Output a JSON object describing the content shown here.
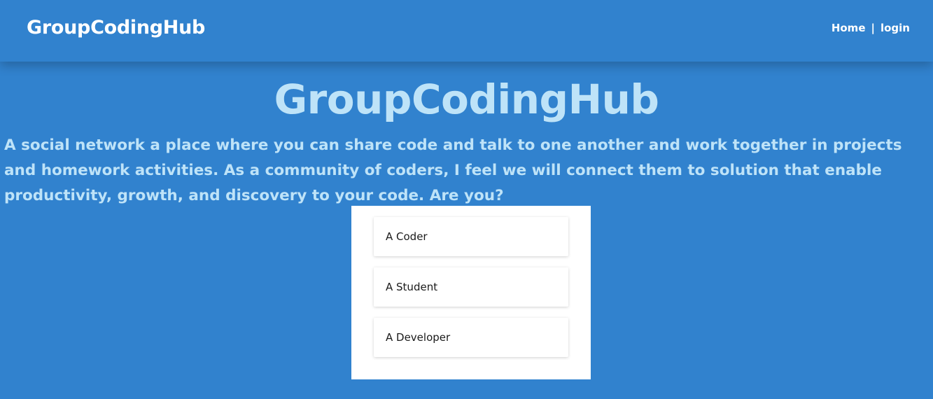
{
  "navbar": {
    "brand": "GroupCodingHub",
    "links": [
      {
        "label": "Home"
      },
      {
        "label": "login"
      }
    ],
    "separator": "|"
  },
  "hero": {
    "title": "GroupCodingHub",
    "description": "A social network a place where you can share code and talk to one another and work together in projects and homework activities. As a community of coders, I feel we will connect them to solution that enable productivity, growth, and discovery to your code. Are you?"
  },
  "choices": [
    {
      "label": "A Coder"
    },
    {
      "label": "A Student"
    },
    {
      "label": "A Developer"
    }
  ],
  "colors": {
    "background": "#3182ce",
    "hero_text": "#bee3f8",
    "nav_text": "#ffffff",
    "card": "#ffffff"
  }
}
